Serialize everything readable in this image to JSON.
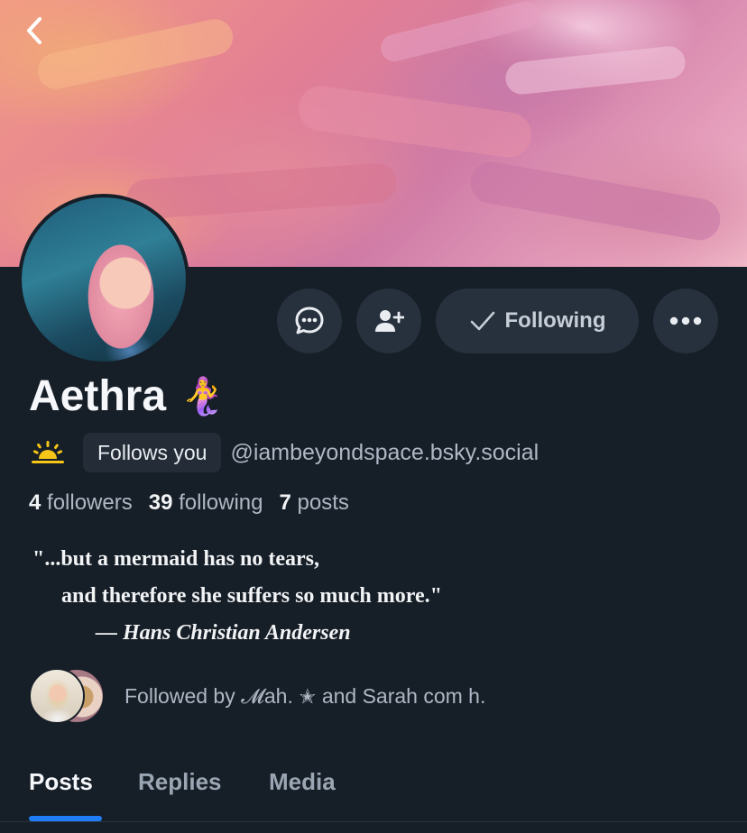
{
  "profile": {
    "display_name": "Aethra",
    "name_emoji": "🧜‍♀️",
    "status_emoji": "🌅",
    "follows_you_label": "Follows you",
    "handle": "@iambeyondspace.bsky.social",
    "stats": {
      "followers_count": "4",
      "followers_label": "followers",
      "following_count": "39",
      "following_label": "following",
      "posts_count": "7",
      "posts_label": "posts"
    },
    "bio": {
      "line1": "\"...but a mermaid has no tears,",
      "line2": "and therefore she suffers so much more.\"",
      "line3": "— Hans Christian Andersen"
    },
    "followed_by": {
      "prefix": "Followed by",
      "name1": "𝓜ah. ✭",
      "connector": "and",
      "name2": "Sarah com h."
    }
  },
  "actions": {
    "following_label": "Following"
  },
  "tabs": [
    {
      "label": "Posts",
      "active": true
    },
    {
      "label": "Replies",
      "active": false
    },
    {
      "label": "Media",
      "active": false
    }
  ],
  "colors": {
    "background": "#161e27",
    "button_bg": "#27313d",
    "accent_blue": "#1f7ef5",
    "muted_text": "#aeb8c4"
  },
  "icons": {
    "back": "chevron-left-icon",
    "message": "chat-bubble-icon",
    "add_user": "add-user-icon",
    "following_check": "checkmark-icon",
    "more": "ellipsis-icon"
  }
}
